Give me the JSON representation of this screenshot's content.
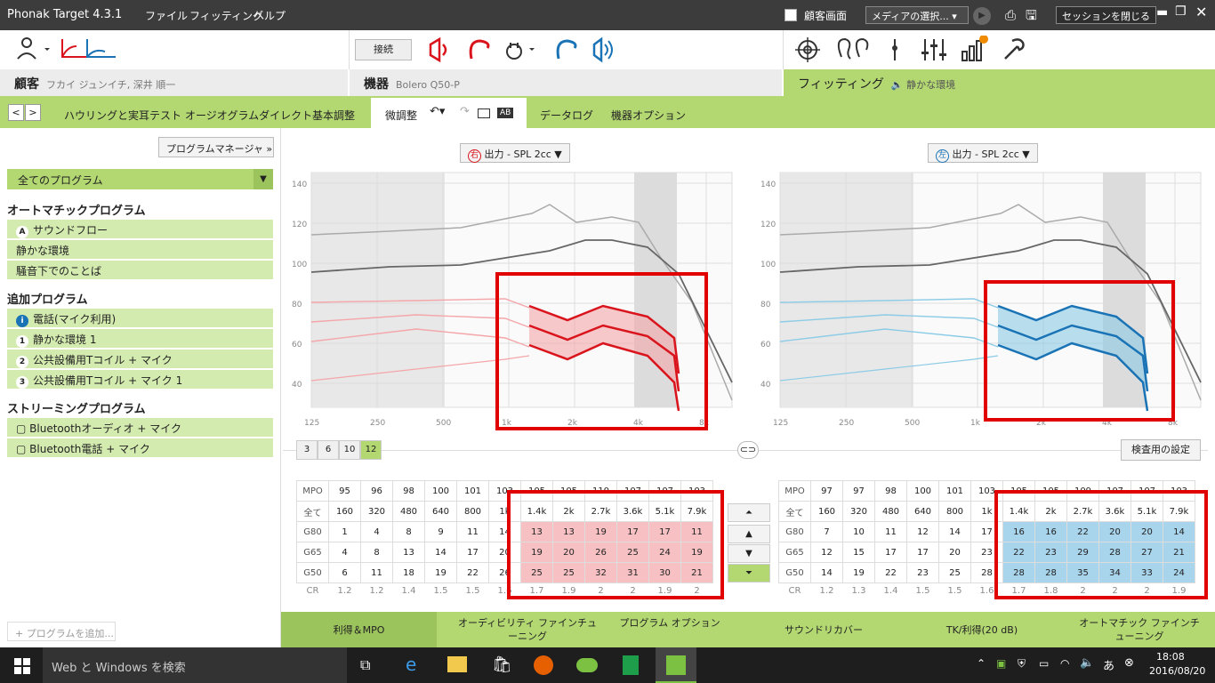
{
  "title_bar": {
    "app_title": "Phonak Target 4.3.1",
    "menu": [
      "ファイル",
      "フィッティング",
      "ヘルプ"
    ],
    "client_screen_label": "顧客画面",
    "media_select": "メディアの選択...",
    "close_session": "セッションを閉じる"
  },
  "toolbar": {
    "connect_label": "接続"
  },
  "sections": {
    "client": {
      "label": "顧客",
      "name": "フカイ ジュンイチ, 深井 順一"
    },
    "device": {
      "label": "機器",
      "model": "Bolero Q50-P"
    },
    "fitting": {
      "label": "フィッティング",
      "program": "静かな環境"
    }
  },
  "tabs": [
    "ハウリングと実耳テスト",
    "オージオグラムダイレクト",
    "基本調整",
    "微調整",
    "データログ",
    "機器オプション"
  ],
  "active_tab": "微調整",
  "ab_label": "AB",
  "sidebar": {
    "program_manager": "プログラムマネージャ",
    "all_programs": "全てのプログラム",
    "groups": [
      {
        "title": "オートマチックプログラム",
        "items": [
          {
            "badge": "A",
            "label": "サウンドフロー"
          },
          {
            "badge": "",
            "label": "静かな環境"
          },
          {
            "badge": "",
            "label": "騒音下でのことば"
          }
        ]
      },
      {
        "title": "追加プログラム",
        "items": [
          {
            "badge": "i",
            "label": "電話(マイク利用)"
          },
          {
            "badge": "1",
            "label": "静かな環境 1"
          },
          {
            "badge": "2",
            "label": "公共設備用Tコイル + マイク"
          },
          {
            "badge": "3",
            "label": "公共設備用Tコイル + マイク 1"
          }
        ]
      },
      {
        "title": "ストリーミングプログラム",
        "items": [
          {
            "badge": "",
            "label": "Bluetoothオーディオ + マイク"
          },
          {
            "badge": "",
            "label": "Bluetooth電話 + マイク"
          }
        ]
      }
    ],
    "add_program": "+ プログラムを追加..."
  },
  "charts": {
    "right_ear": {
      "side_label": "右",
      "output": "出力 - SPL 2cc",
      "color": "#d9141c",
      "light": "#f4a6a9"
    },
    "left_ear": {
      "side_label": "左",
      "output": "出力 - SPL 2cc",
      "color": "#1a73b5",
      "light": "#8ccbe6"
    },
    "y_ticks": [
      "140",
      "120",
      "100",
      "80",
      "60",
      "40"
    ],
    "x_ticks_right": [
      "125",
      "250",
      "500",
      "1k",
      "2k",
      "4k",
      "8k"
    ],
    "x_ticks_left": [
      "125",
      "250",
      "500",
      "1k",
      "2k",
      "4k",
      "8k"
    ]
  },
  "channel_buttons": [
    "3",
    "6",
    "10",
    "12"
  ],
  "active_channels": "12",
  "test_settings": "検査用の設定",
  "gain_tables": {
    "row_labels": [
      "MPO",
      "全て",
      "G80",
      "G65",
      "G50",
      "CR"
    ],
    "freqs": [
      "160",
      "320",
      "480",
      "640",
      "800",
      "1k",
      "1.4k",
      "2k",
      "2.7k",
      "3.6k",
      "5.1k",
      "7.9k"
    ],
    "right": {
      "mpo": [
        "95",
        "96",
        "98",
        "100",
        "101",
        "103",
        "105",
        "105",
        "110",
        "107",
        "107",
        "103"
      ],
      "g80": [
        "1",
        "4",
        "8",
        "9",
        "11",
        "14",
        "13",
        "13",
        "19",
        "17",
        "17",
        "11"
      ],
      "g65": [
        "4",
        "8",
        "13",
        "14",
        "17",
        "20",
        "19",
        "20",
        "26",
        "25",
        "24",
        "19"
      ],
      "g50": [
        "6",
        "11",
        "18",
        "19",
        "22",
        "26",
        "25",
        "25",
        "32",
        "31",
        "30",
        "21"
      ],
      "cr": [
        "1.2",
        "1.2",
        "1.4",
        "1.5",
        "1.5",
        "1.6",
        "1.7",
        "1.9",
        "2",
        "2",
        "1.9",
        "2"
      ]
    },
    "left": {
      "mpo": [
        "97",
        "97",
        "98",
        "100",
        "101",
        "103",
        "105",
        "105",
        "109",
        "107",
        "107",
        "103"
      ],
      "g80": [
        "7",
        "10",
        "11",
        "12",
        "14",
        "17",
        "16",
        "16",
        "22",
        "20",
        "20",
        "14"
      ],
      "g65": [
        "12",
        "15",
        "17",
        "17",
        "20",
        "23",
        "22",
        "23",
        "29",
        "28",
        "27",
        "21"
      ],
      "g50": [
        "14",
        "19",
        "22",
        "23",
        "25",
        "28",
        "28",
        "28",
        "35",
        "34",
        "33",
        "24"
      ],
      "cr": [
        "1.2",
        "1.3",
        "1.4",
        "1.5",
        "1.5",
        "1.6",
        "1.7",
        "1.8",
        "2",
        "2",
        "2",
        "1.9"
      ]
    }
  },
  "bottom_tabs": [
    "利得＆MPO",
    "オーディビリティ ファインチューニング",
    "プログラム オプション",
    "サウンドリカバー",
    "TK/利得(20 dB)",
    "オートマチック ファインチューニング"
  ],
  "taskbar": {
    "search": "Web と Windows を検索",
    "time": "18:08",
    "date": "2016/08/20"
  }
}
